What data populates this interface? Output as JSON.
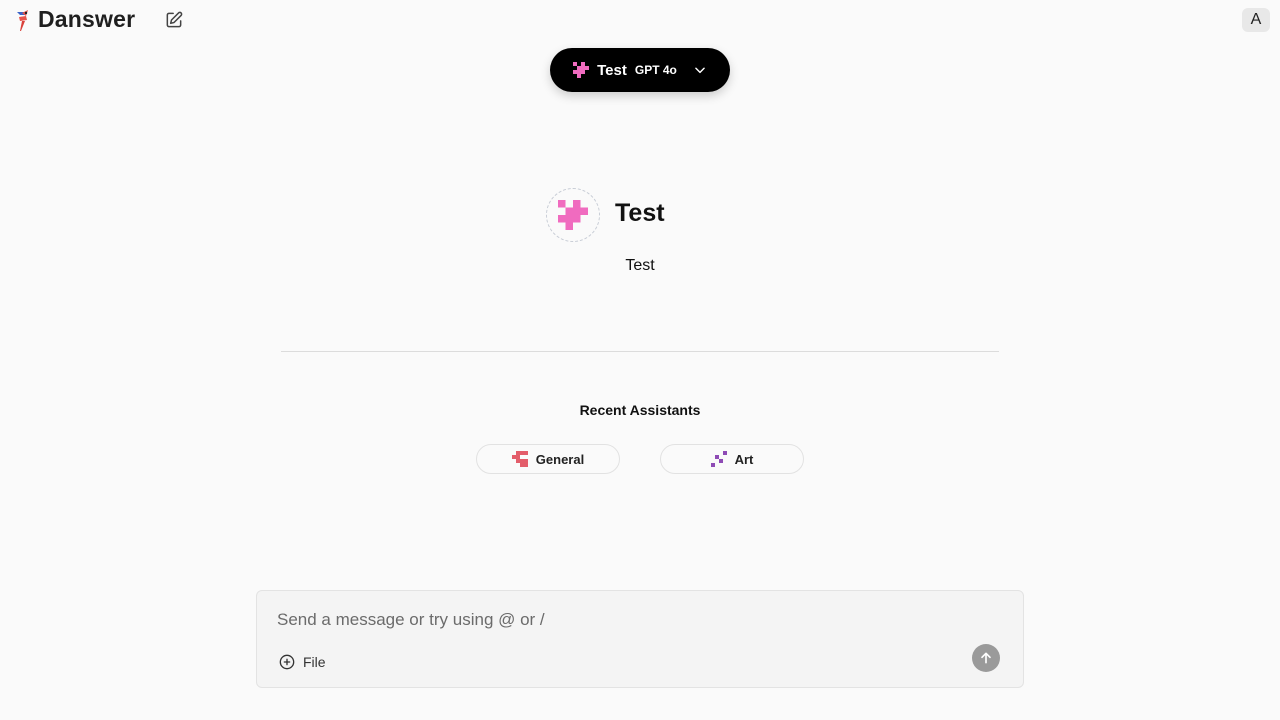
{
  "app": {
    "name": "Danswer",
    "icons": {
      "logo": "danswer-logo-icon",
      "new_chat": "edit-square-icon"
    }
  },
  "user": {
    "initial": "A"
  },
  "assistant_selector": {
    "assistant_name": "Test",
    "model": "GPT 4o",
    "icon": "pixel-assistant-icon",
    "chevron": "chevron-down-icon",
    "icon_color": "#f06bbf"
  },
  "hero": {
    "name": "Test",
    "description": "Test",
    "icon_color": "#f06bbf"
  },
  "recent": {
    "title": "Recent Assistants",
    "items": [
      {
        "label": "General",
        "icon": "pixel-assistant-icon",
        "color": "#e35d6a"
      },
      {
        "label": "Art",
        "icon": "pixel-assistant-icon",
        "color": "#8e4bb5"
      }
    ]
  },
  "composer": {
    "placeholder": "Send a message or try using @ or /",
    "value": "",
    "file_label": "File",
    "icons": {
      "file": "plus-circle-icon",
      "send": "arrow-up-icon"
    }
  }
}
